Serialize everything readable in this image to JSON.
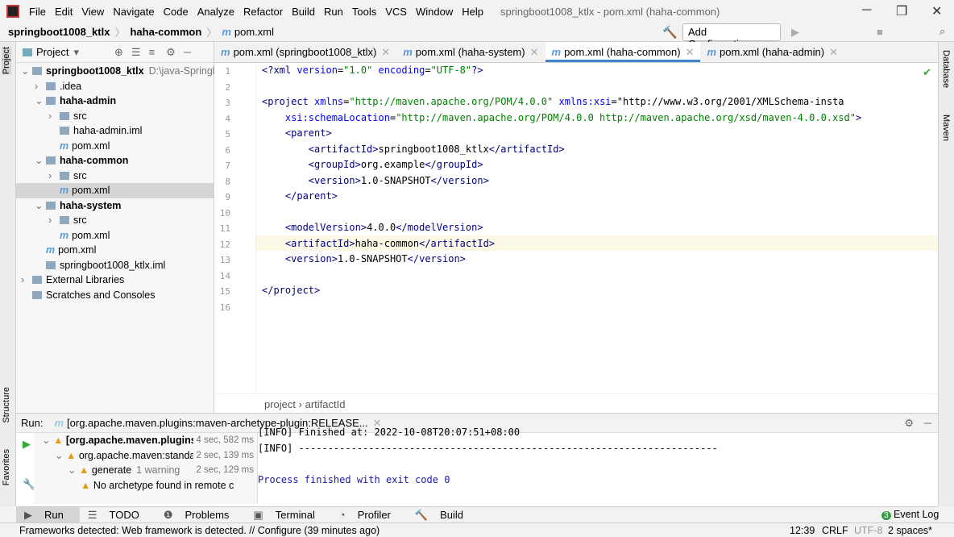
{
  "menu": [
    "File",
    "Edit",
    "View",
    "Navigate",
    "Code",
    "Analyze",
    "Refactor",
    "Build",
    "Run",
    "Tools",
    "VCS",
    "Window",
    "Help"
  ],
  "window_title": "springboot1008_ktlx - pom.xml (haha-common)",
  "breadcrumb": [
    "springboot1008_ktlx",
    "haha-common",
    "pom.xml"
  ],
  "toolbar": {
    "add_config": "Add Configuration..."
  },
  "left_tabs": [
    "Project",
    "Structure",
    "Favorites"
  ],
  "right_tabs": [
    "Database",
    "Maven"
  ],
  "project": {
    "title": "Project",
    "tree": [
      {
        "label": "springboot1008_ktlx",
        "extra": "D:\\java-Springbo",
        "depth": 0,
        "bold": true
      },
      {
        "label": ".idea",
        "depth": 1
      },
      {
        "label": "haha-admin",
        "depth": 1,
        "bold": true
      },
      {
        "label": "src",
        "depth": 2
      },
      {
        "label": "haha-admin.iml",
        "depth": 2
      },
      {
        "label": "pom.xml",
        "depth": 2
      },
      {
        "label": "haha-common",
        "depth": 1,
        "bold": true
      },
      {
        "label": "src",
        "depth": 2
      },
      {
        "label": "pom.xml",
        "depth": 2,
        "selected": true
      },
      {
        "label": "haha-system",
        "depth": 1,
        "bold": true
      },
      {
        "label": "src",
        "depth": 2
      },
      {
        "label": "pom.xml",
        "depth": 2
      },
      {
        "label": "pom.xml",
        "depth": 1
      },
      {
        "label": "springboot1008_ktlx.iml",
        "depth": 1
      },
      {
        "label": "External Libraries",
        "depth": 0
      },
      {
        "label": "Scratches and Consoles",
        "depth": 0
      }
    ]
  },
  "tabs": [
    {
      "label": "pom.xml (springboot1008_ktlx)"
    },
    {
      "label": "pom.xml (haha-system)"
    },
    {
      "label": "pom.xml (haha-common)",
      "active": true
    },
    {
      "label": "pom.xml (haha-admin)"
    }
  ],
  "code": [
    "<?xml version=\"1.0\" encoding=\"UTF-8\"?>",
    "",
    "<project xmlns=\"http://maven.apache.org/POM/4.0.0\" xmlns:xsi=\"http://www.w3.org/2001/XMLSchema-insta",
    "    xsi:schemaLocation=\"http://maven.apache.org/POM/4.0.0 http://maven.apache.org/xsd/maven-4.0.0.xsd\">",
    "    <parent>",
    "        <artifactId>springboot1008_ktlx</artifactId>",
    "        <groupId>org.example</groupId>",
    "        <version>1.0-SNAPSHOT</version>",
    "    </parent>",
    "",
    "    <modelVersion>4.0.0</modelVersion>",
    "    <artifactId>haha-common</artifactId>",
    "    <version>1.0-SNAPSHOT</version>",
    "",
    "</project>",
    ""
  ],
  "editor_crumb": [
    "project",
    "artifactId"
  ],
  "run": {
    "label": "Run:",
    "tab": "[org.apache.maven.plugins:maven-archetype-plugin:RELEASE...",
    "tree": [
      {
        "label": "[org.apache.maven.plugins:",
        "time": "4 sec, 582 ms",
        "depth": 0
      },
      {
        "label": "org.apache.maven:standa",
        "time": "2 sec, 139 ms",
        "depth": 1
      },
      {
        "label": "generate",
        "note": "1 warning",
        "time": "2 sec, 129 ms",
        "depth": 2
      },
      {
        "label": "No archetype found in remote c",
        "depth": 3
      }
    ],
    "console": [
      "[INFO] Finished at: 2022-10-08T20:07:51+08:00",
      "[INFO] ------------------------------------------------------------------------",
      "",
      "Process finished with exit code 0"
    ]
  },
  "bottom_tabs": [
    "Run",
    "TODO",
    "Problems",
    "Terminal",
    "Profiler",
    "Build"
  ],
  "event_log": {
    "count": "3",
    "label": "Event Log"
  },
  "status": {
    "message": "Frameworks detected: Web framework is detected. // Configure (39 minutes ago)",
    "position": "12:39",
    "line_sep": "CRLF",
    "encoding": "UTF-8",
    "indent": "2 spaces*"
  }
}
